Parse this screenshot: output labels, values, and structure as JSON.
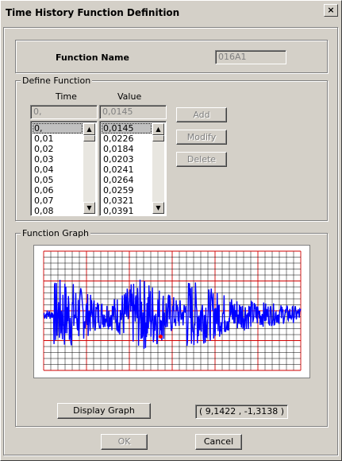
{
  "window": {
    "title": "Time History  Function Definition",
    "close_glyph": "×"
  },
  "function_name": {
    "label": "Function Name",
    "value": "016A1"
  },
  "define_function": {
    "legend": "Define Function",
    "time_header": "Time",
    "value_header": "Value",
    "time_input": "0,",
    "value_input": "0,0145",
    "times": [
      "0,",
      "0,01",
      "0,02",
      "0,03",
      "0,04",
      "0,05",
      "0,06",
      "0,07",
      "0,08"
    ],
    "values": [
      "0,0145",
      "0,0226",
      "0,0184",
      "0,0203",
      "0,0241",
      "0,0264",
      "0,0259",
      "0,0321",
      "0,0391"
    ],
    "buttons": {
      "add": "Add",
      "modify": "Modify",
      "delete": "Delete"
    }
  },
  "function_graph": {
    "legend": "Function Graph",
    "display_button": "Display Graph",
    "coordinate_readout": "( 9,1422  ,  -1,3138 )"
  },
  "footer": {
    "ok": "OK",
    "cancel": "Cancel"
  },
  "colors": {
    "dialog_bg": "#d4d0c8",
    "grid_minor": "#000000",
    "grid_major": "#d00000",
    "signal": "#0000ff",
    "marker": "#ff0000"
  }
}
